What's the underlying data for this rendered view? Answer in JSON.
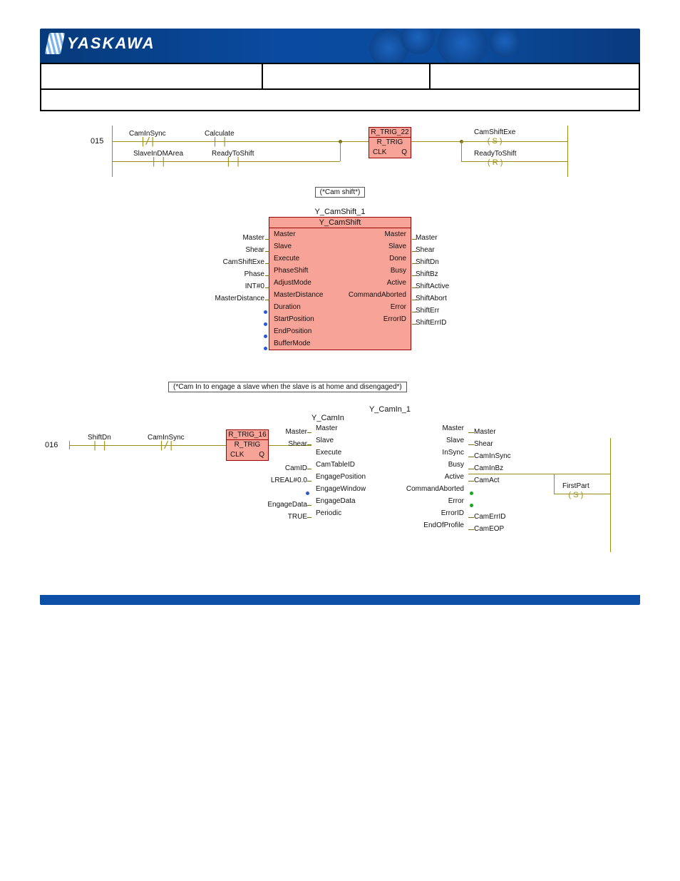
{
  "brand": "YASKAWA",
  "rung015": {
    "num": "015",
    "contacts_top": [
      "CamInSync",
      "Calculate"
    ],
    "contacts_bot": [
      "SlaveInDMArea",
      "ReadyToShift"
    ],
    "rtrig": {
      "inst": "R_TRIG_22",
      "type": "R_TRIG",
      "l": "CLK",
      "r": "Q"
    },
    "coil1": "CamShiftExe",
    "coil1_sym": "( S )",
    "coil2": "ReadyToShift",
    "coil2_sym": "( R )"
  },
  "comment1": "(*Cam shift*)",
  "camshift": {
    "inst": "Y_CamShift_1",
    "type": "Y_CamShift",
    "rows": [
      {
        "li": "Master",
        "l": "Master",
        "r": "Master",
        "ri": "Master"
      },
      {
        "li": "Shear",
        "l": "Slave",
        "r": "Slave",
        "ri": "Shear"
      },
      {
        "li": "CamShiftExe",
        "l": "Execute",
        "r": "Done",
        "ri": "ShiftDn"
      },
      {
        "li": "Phase",
        "l": "PhaseShift",
        "r": "Busy",
        "ri": "ShiftBz"
      },
      {
        "li": "INT#0",
        "l": "AdjustMode",
        "r": "Active",
        "ri": "ShiftActive"
      },
      {
        "li": "MasterDistance",
        "l": "MasterDistance",
        "r": "CommandAborted",
        "ri": "ShiftAbort"
      },
      {
        "li": "",
        "l": "Duration",
        "r": "Error",
        "ri": "ShiftErr",
        "dot": true
      },
      {
        "li": "",
        "l": "StartPosition",
        "r": "ErrorID",
        "ri": "ShiftErrID",
        "dot": true
      },
      {
        "li": "",
        "l": "EndPosition",
        "r": "",
        "ri": "",
        "dot": true
      },
      {
        "li": "",
        "l": "BufferMode",
        "r": "",
        "ri": "",
        "dot": true
      }
    ]
  },
  "comment2": "(*Cam In to engage a slave when the slave is at home and disengaged*)",
  "rung016": {
    "num": "016",
    "c1": "ShiftDn",
    "c2": "CamInSync",
    "rtrig": {
      "inst": "R_TRIG_16",
      "type": "R_TRIG",
      "l": "CLK",
      "r": "Q"
    }
  },
  "camin": {
    "inst": "Y_CamIn_1",
    "type": "Y_CamIn",
    "rows": [
      {
        "li": "Master",
        "l": "Master",
        "r": "Master",
        "ri": "Master"
      },
      {
        "li": "Shear",
        "l": "Slave",
        "r": "Slave",
        "ri": "Shear"
      },
      {
        "li": "",
        "l": "Execute",
        "r": "InSync",
        "ri": "CamInSync"
      },
      {
        "li": "CamID",
        "l": "CamTableID",
        "r": "Busy",
        "ri": "CamInBz"
      },
      {
        "li": "LREAL#0.0",
        "l": "EngagePosition",
        "r": "Active",
        "ri": "CamAct"
      },
      {
        "li": "",
        "l": "EngageWindow",
        "r": "CommandAborted",
        "ri": "",
        "dot": true,
        "rgreen": true
      },
      {
        "li": "EngageData",
        "l": "EngageData",
        "r": "Error",
        "ri": "",
        "rgreen": true
      },
      {
        "li": "TRUE",
        "l": "Periodic",
        "r": "ErrorID",
        "ri": "CamErrID"
      },
      {
        "li": "",
        "l": "",
        "r": "EndOfProfile",
        "ri": "CamEOP"
      }
    ],
    "coil": "FirstPart",
    "coil_sym": "( S )"
  }
}
